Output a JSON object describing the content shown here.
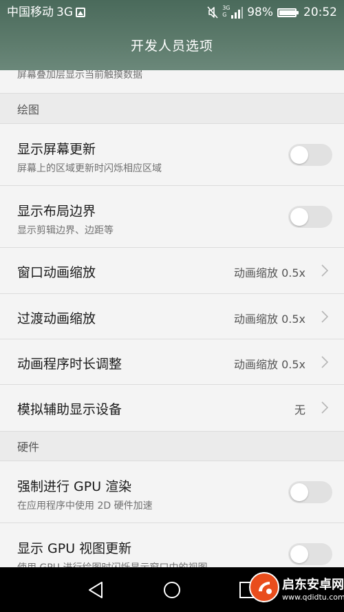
{
  "status_bar": {
    "carrier": "中国移动",
    "network": "3G",
    "signal_small": "3G",
    "signal_small_2": "G",
    "battery": "98%",
    "time": "20:52",
    "icons": [
      "image-notification-icon",
      "mute-icon",
      "signal-icon",
      "battery-icon"
    ]
  },
  "app_bar": {
    "title": "开发人员选项"
  },
  "partial_top": {
    "subtitle": "屏幕叠加层显示当前触摸数据"
  },
  "sections": [
    {
      "header": "绘图",
      "items": [
        {
          "title": "显示屏幕更新",
          "subtitle": "屏幕上的区域更新时闪烁相应区域",
          "type": "toggle",
          "on": false
        },
        {
          "title": "显示布局边界",
          "subtitle": "显示剪辑边界、边距等",
          "type": "toggle",
          "on": false
        },
        {
          "title": "窗口动画缩放",
          "value": "动画缩放 0.5x",
          "type": "select"
        },
        {
          "title": "过渡动画缩放",
          "value": "动画缩放 0.5x",
          "type": "select"
        },
        {
          "title": "动画程序时长调整",
          "value": "动画缩放 0.5x",
          "type": "select"
        },
        {
          "title": "模拟辅助显示设备",
          "value": "无",
          "type": "select"
        }
      ]
    },
    {
      "header": "硬件",
      "items": [
        {
          "title": "强制进行 GPU 渲染",
          "subtitle": "在应用程序中使用 2D 硬件加速",
          "type": "toggle",
          "on": false
        },
        {
          "title": "显示 GPU 视图更新",
          "subtitle": "使用 GPU 进行绘图时闪烁显示窗口中的视图",
          "type": "toggle",
          "on": false
        }
      ]
    }
  ],
  "nav_bar": {
    "buttons": [
      "back-icon",
      "home-icon",
      "recents-icon"
    ]
  },
  "watermark": {
    "name": "启东安卓网",
    "url": "www.qdidtu.com"
  },
  "colors": {
    "header_bg": "#5d7b6c",
    "page_bg": "#f4f4f4",
    "section_bg": "#ebebeb",
    "toggle_off": "#e1e1e1",
    "watermark_accent": "#e94d1c"
  }
}
